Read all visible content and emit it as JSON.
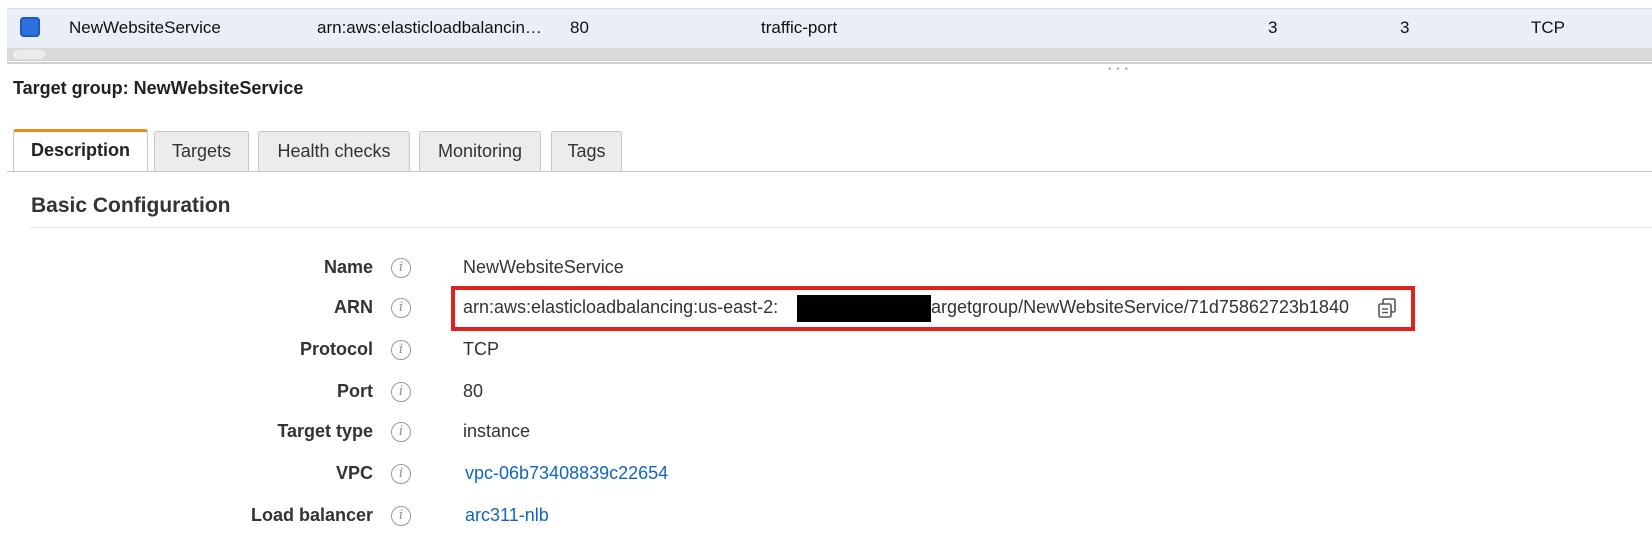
{
  "table_row": {
    "name": "NewWebsiteService",
    "arn": "arn:aws:elasticloadbalancin…",
    "port": "80",
    "health_port": "traffic-port",
    "healthy_threshold": "3",
    "unhealthy_threshold": "3",
    "protocol": "TCP"
  },
  "panel": {
    "title": "Target group: NewWebsiteService"
  },
  "tabs": [
    {
      "label": "Description"
    },
    {
      "label": "Targets"
    },
    {
      "label": "Health checks"
    },
    {
      "label": "Monitoring"
    },
    {
      "label": "Tags"
    }
  ],
  "section": {
    "title": "Basic Configuration"
  },
  "fields": {
    "name": {
      "label": "Name",
      "value": "NewWebsiteService"
    },
    "arn": {
      "label": "ARN",
      "value_prefix": "arn:aws:elasticloadbalancing:us-east-2:",
      "value_suffix": "argetgroup/NewWebsiteService/71d75862723b1840"
    },
    "protocol": {
      "label": "Protocol",
      "value": "TCP"
    },
    "port": {
      "label": "Port",
      "value": "80"
    },
    "target_type": {
      "label": "Target type",
      "value": "instance"
    },
    "vpc": {
      "label": "VPC",
      "value": "vpc-06b73408839c22654"
    },
    "load_balancer": {
      "label": "Load balancer",
      "value": "arc311-nlb"
    }
  },
  "colors": {
    "accent_tab": "#ec8a16",
    "link": "#1166bb",
    "highlight_box": "#e0221f",
    "row_selected": "#e9eef7"
  },
  "icons": {
    "info": "info-icon",
    "copy": "copy-icon",
    "checkbox": "checkbox-checked-icon"
  }
}
